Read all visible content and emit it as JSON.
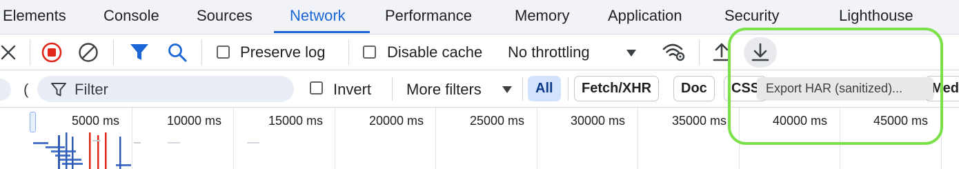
{
  "tabs": [
    {
      "label": "Elements"
    },
    {
      "label": "Console"
    },
    {
      "label": "Sources"
    },
    {
      "label": "Network"
    },
    {
      "label": "Performance"
    },
    {
      "label": "Memory"
    },
    {
      "label": "Application"
    },
    {
      "label": "Security"
    },
    {
      "label": "Lighthouse"
    }
  ],
  "active_tab": "Network",
  "toolbar": {
    "preserve_log_label": "Preserve log",
    "preserve_log_checked": false,
    "disable_cache_label": "Disable cache",
    "disable_cache_checked": false,
    "throttling_value": "No throttling",
    "icons": [
      "close-icon",
      "record-stop-icon",
      "clear-icon",
      "filter-funnel-icon",
      "search-icon",
      "network-conditions-icon",
      "import-har-icon",
      "export-har-icon"
    ]
  },
  "filter_row": {
    "filter_placeholder": "Filter",
    "invert_label": "Invert",
    "invert_checked": false,
    "more_filters_label": "More filters",
    "chips": [
      "All",
      "Fetch/XHR",
      "Doc",
      "CSS",
      "Med"
    ],
    "selected_chip": "All"
  },
  "tooltip": {
    "text": "Export HAR (sanitized)..."
  },
  "timeline": {
    "ticks": [
      "5000 ms",
      "10000 ms",
      "15000 ms",
      "20000 ms",
      "25000 ms",
      "30000 ms",
      "35000 ms",
      "40000 ms",
      "45000 ms"
    ]
  },
  "colors": {
    "accent": "#1a66d6",
    "record_red": "#e0271a",
    "highlight_green": "#7be04a",
    "chip_selected_bg": "#d3e3fd"
  }
}
